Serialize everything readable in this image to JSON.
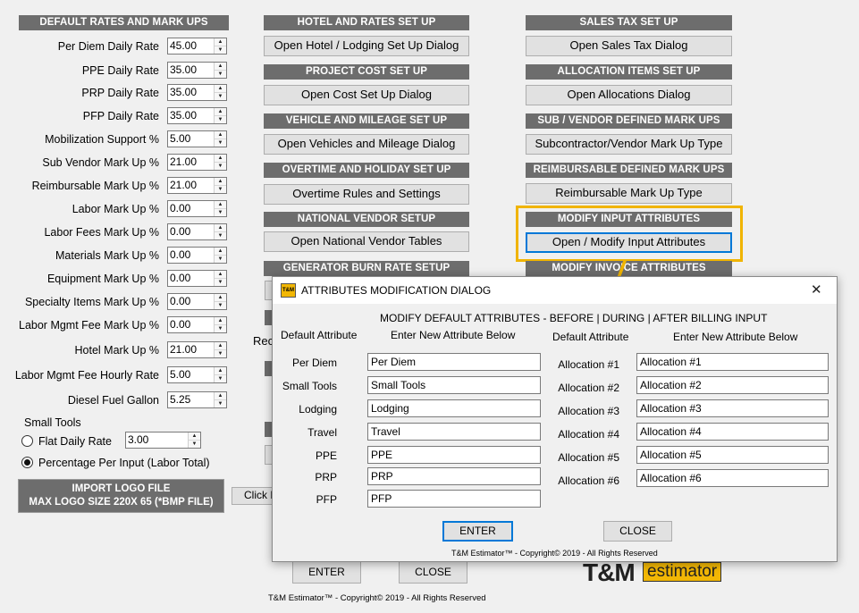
{
  "default_rates": {
    "header": "DEFAULT RATES AND MARK UPS",
    "fields": [
      {
        "label": "Per Diem Daily Rate",
        "value": "45.00"
      },
      {
        "label": "PPE Daily Rate",
        "value": "35.00"
      },
      {
        "label": "PRP Daily Rate",
        "value": "35.00"
      },
      {
        "label": "PFP Daily Rate",
        "value": "35.00"
      },
      {
        "label": "Mobilization Support %",
        "value": "5.00"
      },
      {
        "label": "Sub Vendor Mark Up %",
        "value": "21.00"
      },
      {
        "label": "Reimbursable Mark Up %",
        "value": "21.00"
      },
      {
        "label": "Labor Mark Up  %",
        "value": "0.00"
      },
      {
        "label": "Labor Fees Mark Up  %",
        "value": "0.00"
      },
      {
        "label": "Materials Mark Up  %",
        "value": "0.00"
      },
      {
        "label": "Equipment Mark Up  %",
        "value": "0.00"
      },
      {
        "label": "Specialty Items Mark Up  %",
        "value": "0.00"
      },
      {
        "label": "Labor Mgmt Fee Mark Up  %",
        "value": "0.00"
      },
      {
        "label": "Hotel Mark Up  %",
        "value": "21.00"
      },
      {
        "label": "Labor Mgmt Fee Hourly Rate",
        "value": "5.00"
      },
      {
        "label": "Diesel Fuel Gallon",
        "value": "5.25"
      }
    ],
    "small_tools_label": "Small Tools",
    "flat_daily_rate_label": "Flat Daily Rate",
    "flat_daily_rate_value": "3.00",
    "percentage_label": "Percentage Per Input (Labor Total)",
    "import_logo_line1": "IMPORT LOGO FILE",
    "import_logo_line2": "MAX LOGO SIZE 220X 65 (*BMP FILE)"
  },
  "middle": {
    "hotel_header": "HOTEL AND RATES SET UP",
    "hotel_button": "Open Hotel / Lodging Set Up Dialog",
    "project_header": "PROJECT COST SET UP",
    "project_button": "Open Cost Set Up Dialog",
    "vehicle_header": "VEHICLE AND MILEAGE SET UP",
    "vehicle_button": "Open Vehicles and Mileage Dialog",
    "overtime_header": "OVERTIME AND HOLIDAY SET UP",
    "overtime_button": "Overtime Rules and Settings",
    "national_header": "NATIONAL VENDOR SETUP",
    "national_button": "Open National Vendor Tables",
    "generator_header": "GENERATOR BURN RATE SETUP",
    "partial_rec": "Rec",
    "partial_click": "Click H",
    "enter_button": "ENTER",
    "close_button": "CLOSE",
    "copyright": "T&M Estimator™ - Copyright© 2019 - All Rights Reserved"
  },
  "right": {
    "sales_tax_header": "SALES TAX SET UP",
    "sales_tax_button": "Open Sales Tax Dialog",
    "allocation_header": "ALLOCATION ITEMS SET UP",
    "allocation_button": "Open Allocations Dialog",
    "sub_vendor_header": "SUB / VENDOR DEFINED MARK UPS",
    "sub_vendor_button": "Subcontractor/Vendor Mark Up Type",
    "reimb_header": "REIMBURSABLE DEFINED MARK UPS",
    "reimb_button": "Reimbursable Mark Up Type",
    "modify_input_header": "MODIFY INPUT ATTRIBUTES",
    "modify_input_button": "Open / Modify Input Attributes",
    "modify_invoice_header": "MODIFY INVOICE ATTRIBUTES"
  },
  "logo": {
    "left": "T&M",
    "right": "estimator"
  },
  "dialog": {
    "icon_text": "T&M",
    "title": "ATTRIBUTES MODIFICATION DIALOG",
    "close_glyph": "✕",
    "subtitle": "MODIFY DEFAULT ATTRIBUTES - BEFORE | DURING | AFTER BILLING INPUT",
    "col_default": "Default Attribute",
    "col_enter": "Enter New Attribute Below",
    "left_rows": [
      {
        "label": "Per Diem",
        "value": "Per Diem"
      },
      {
        "label": "Small Tools",
        "value": "Small Tools"
      },
      {
        "label": "Lodging",
        "value": "Lodging"
      },
      {
        "label": "Travel",
        "value": "Travel"
      },
      {
        "label": "PPE",
        "value": "PPE"
      },
      {
        "label": "PRP",
        "value": "PRP"
      },
      {
        "label": "PFP",
        "value": "PFP"
      }
    ],
    "right_rows": [
      {
        "label": "Allocation #1",
        "value": "Allocation #1"
      },
      {
        "label": "Allocation #2",
        "value": "Allocation #2"
      },
      {
        "label": "Allocation #3",
        "value": "Allocation #3"
      },
      {
        "label": "Allocation #4",
        "value": "Allocation #4"
      },
      {
        "label": "Allocation #5",
        "value": "Allocation #5"
      },
      {
        "label": "Allocation #6",
        "value": "Allocation #6"
      }
    ],
    "enter_button": "ENTER",
    "close_button": "CLOSE",
    "copyright": "T&M Estimator™ - Copyright© 2019 - All Rights Reserved"
  },
  "colors": {
    "header_bg": "#6d6d6d",
    "highlight": "#f0b400",
    "logo_yellow": "#f2b705",
    "focus_blue": "#0078d7"
  }
}
